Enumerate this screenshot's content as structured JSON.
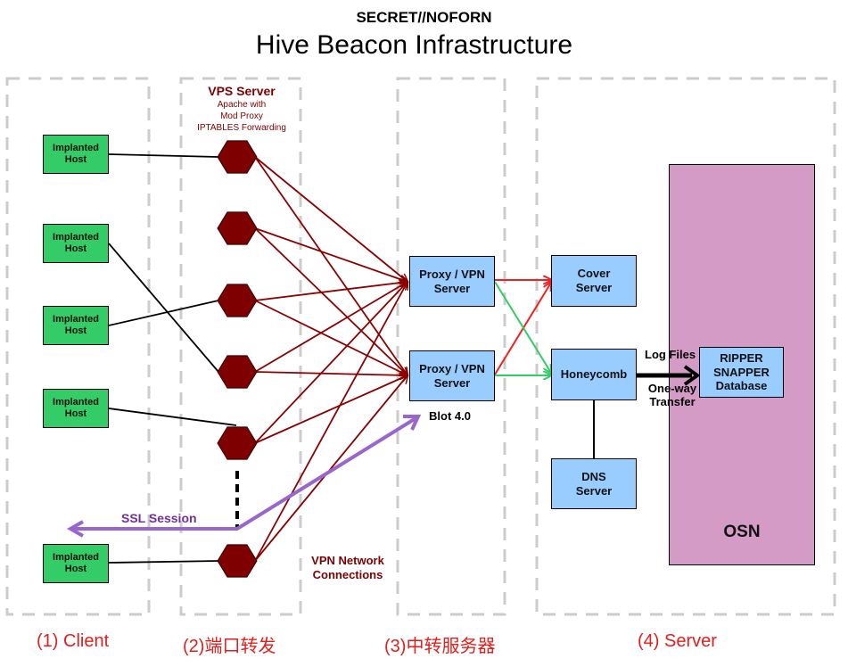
{
  "header": {
    "classification": "SECRET//NOFORN",
    "title": "Hive Beacon Infrastructure"
  },
  "columns": [
    {
      "id": "client",
      "label": "(1) Client"
    },
    {
      "id": "port-forward",
      "label": "(2)端口转发"
    },
    {
      "id": "relay",
      "label": "(3)中转服务器"
    },
    {
      "id": "server",
      "label": "(4) Server"
    }
  ],
  "vps": {
    "title": "VPS Server",
    "subtitle": "Apache with\nMod  Proxy\nIPTABLES  Forwarding"
  },
  "implanted_hosts": [
    {
      "label": "Implanted Host"
    },
    {
      "label": "Implanted Host"
    },
    {
      "label": "Implanted Host"
    },
    {
      "label": "Implanted Host"
    },
    {
      "label": "Implanted Host"
    }
  ],
  "proxy_servers": [
    {
      "label": "Proxy / VPN Server"
    },
    {
      "label": "Proxy / VPN Server"
    }
  ],
  "blot_label": "Blot 4.0",
  "servers": {
    "cover": "Cover Server",
    "honeycomb": "Honeycomb",
    "dns": "DNS Server",
    "ripper": "RIPPER SNAPPER Database"
  },
  "labels": {
    "log_files": "Log Files",
    "one_way": "One-way Transfer",
    "ssl_session": "SSL Session",
    "vpn_network": "VPN Network Connections",
    "osn": "OSN"
  },
  "colors": {
    "host_green": "#33cc66",
    "server_blue": "#99ccff",
    "osn_pink": "#d39bc6",
    "vps_hex": "#7f0000",
    "vpn_lines": "#8b0000",
    "ssl_purple": "#9966cc",
    "red_arrow": "#ee2222",
    "green_arrow": "#33cc66",
    "column_label_red": "#e0201e",
    "dashed_border": "#cccccc"
  }
}
